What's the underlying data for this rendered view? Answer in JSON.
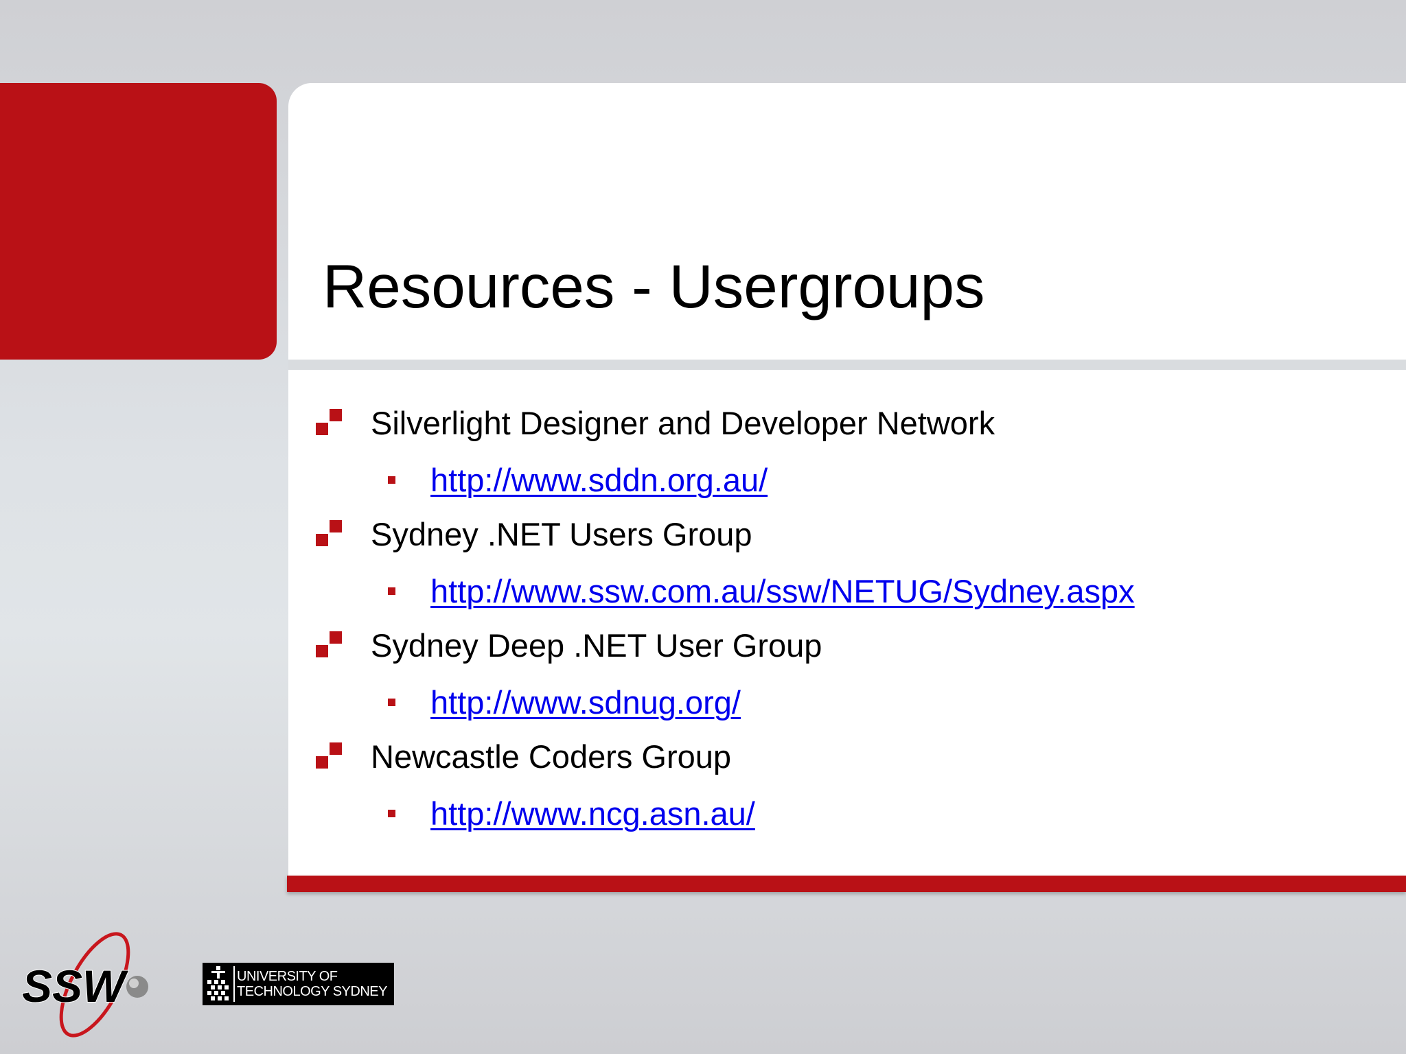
{
  "slide": {
    "title": "Resources - Usergroups",
    "items": [
      {
        "label": "Silverlight Designer and Developer Network",
        "link": "http://www.sddn.org.au/"
      },
      {
        "label": "Sydney .NET Users Group",
        "link": "http://www.ssw.com.au/ssw/NETUG/Sydney.aspx"
      },
      {
        "label": "Sydney Deep .NET User Group",
        "link": "http://www.sdnug.org/"
      },
      {
        "label": "Newcastle Coders Group",
        "link": "http://www.ncg.asn.au/"
      }
    ]
  },
  "logos": {
    "ssw": "SSW",
    "uts_line1": "UNIVERSITY OF",
    "uts_line2": "TECHNOLOGY SYDNEY"
  },
  "colors": {
    "accent": "#b91116",
    "link": "#0000ee",
    "background": "#dee2e6"
  }
}
